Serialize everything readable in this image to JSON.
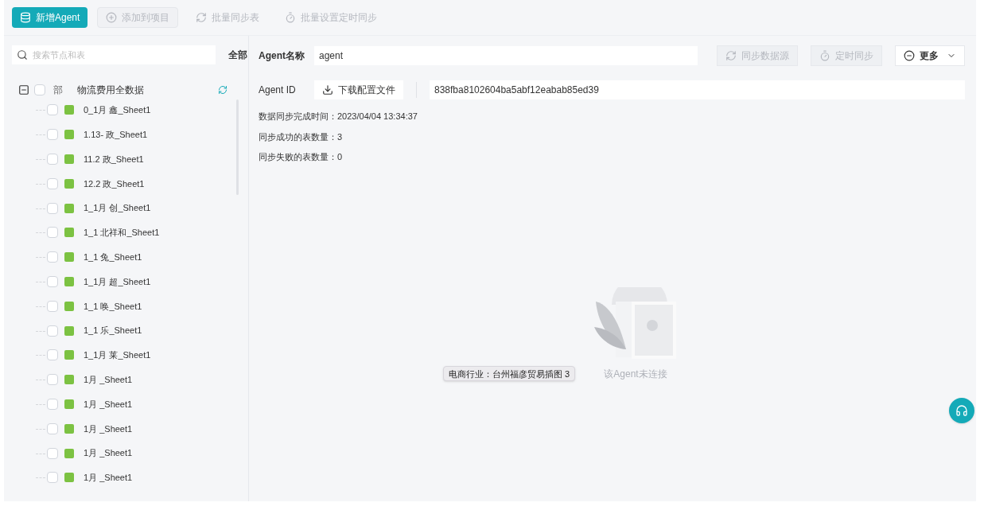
{
  "toolbar": [
    {
      "label": "新增Agent",
      "kind": "primary",
      "disabled": false
    },
    {
      "label": "添加到项目",
      "kind": "plus",
      "disabled": true
    },
    {
      "label": "批量同步表",
      "kind": "sync",
      "disabled": true
    },
    {
      "label": "批量设置定时同步",
      "kind": "timer",
      "disabled": true
    }
  ],
  "sidebar": {
    "search": {
      "placeholder": "搜索节点和表"
    },
    "filter": "全部",
    "tree": {
      "label": "物流费用全数据",
      "prefix": "部",
      "expanded": true,
      "checked": false,
      "children": [
        {
          "label": "0_1月 鑫_Sheet1",
          "checked": false
        },
        {
          "label": "1.13- 政_Sheet1",
          "checked": false
        },
        {
          "label": "11.2 政_Sheet1",
          "checked": false
        },
        {
          "label": "12.2 政_Sheet1",
          "checked": false
        },
        {
          "label": "1_1月 创_Sheet1",
          "checked": false
        },
        {
          "label": "1_1 北祥和_Sheet1",
          "checked": false
        },
        {
          "label": "1_1 兔_Sheet1",
          "checked": false
        },
        {
          "label": "1_1月 超_Sheet1",
          "checked": false
        },
        {
          "label": "1_1 唤_Sheet1",
          "checked": false
        },
        {
          "label": "1_1 乐_Sheet1",
          "checked": false
        },
        {
          "label": "1_1月 莱_Sheet1",
          "checked": false
        },
        {
          "label": "1月 _Sheet1",
          "checked": false
        },
        {
          "label": "1月 _Sheet1",
          "checked": false
        },
        {
          "label": "1月 _Sheet1",
          "checked": false
        },
        {
          "label": "1月 _Sheet1",
          "checked": false
        },
        {
          "label": "1月 _Sheet1",
          "checked": false
        }
      ]
    }
  },
  "detail": {
    "name_label": "Agent名称",
    "name_value": "agent",
    "actions": [
      {
        "label": "同步数据源",
        "kind": "sync",
        "disabled": true
      },
      {
        "label": "定时同步",
        "kind": "timer",
        "disabled": true
      },
      {
        "label": "更多",
        "kind": "more",
        "disabled": false
      }
    ],
    "id_label": "Agent ID",
    "download": "下载配置文件",
    "id_value": "838fba8102604ba5abf12eabab85ed39",
    "info": [
      "数据同步完成时间：2023/04/04 13:34:37",
      "同步成功的表数量：3",
      "同步失败的表数量：0"
    ],
    "empty_text": "该Agent未连接"
  },
  "tooltip": "电商行业：台州福彦贸易插图 3"
}
